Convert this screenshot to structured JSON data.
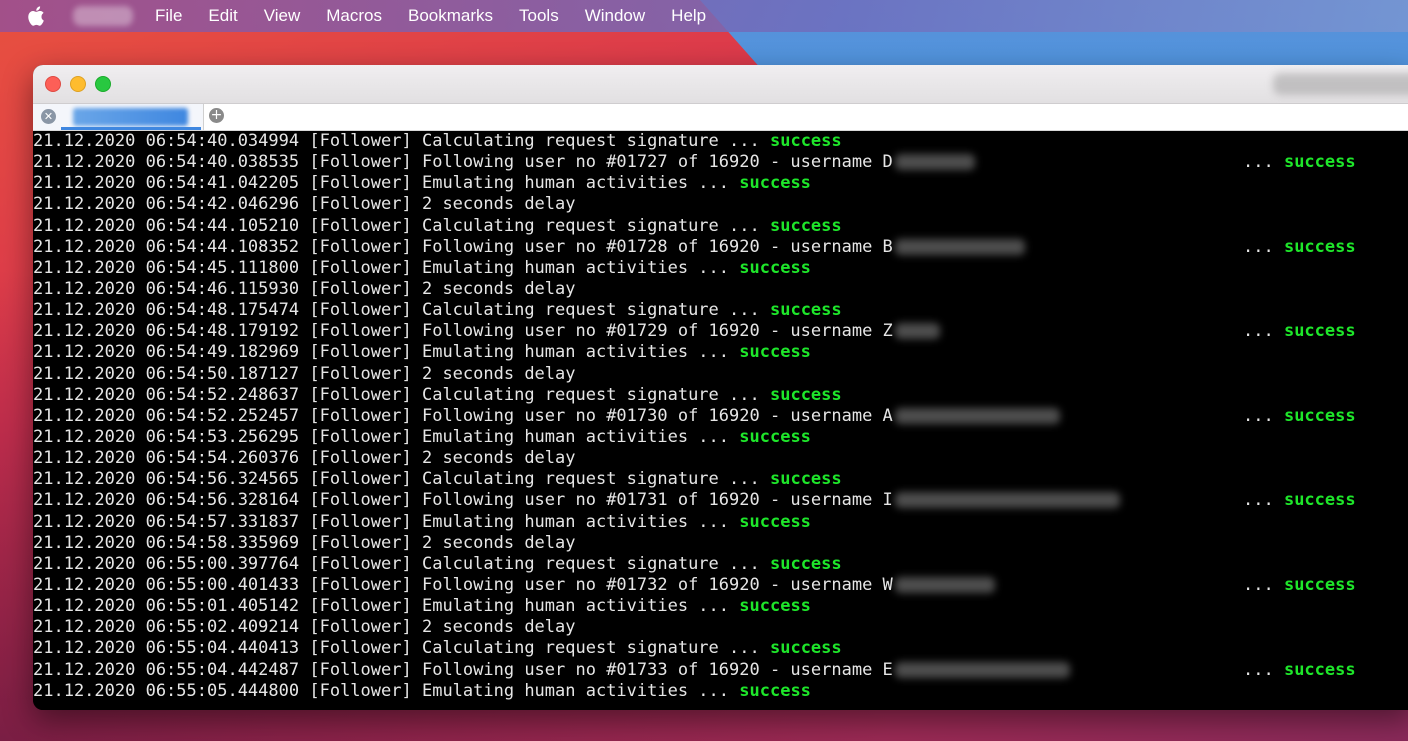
{
  "menubar": {
    "items": [
      "File",
      "Edit",
      "View",
      "Macros",
      "Bookmarks",
      "Tools",
      "Window",
      "Help"
    ]
  },
  "terminal": {
    "lines": [
      {
        "kind": "calc",
        "ts": "21.12.2020 06:54:40.034994",
        "tag": "[Follower]",
        "text": "Calculating request signature ...",
        "status": "success"
      },
      {
        "kind": "follow",
        "ts": "21.12.2020 06:54:40.038535",
        "tag": "[Follower]",
        "text": "Following user no #01727 of 16920 - username D",
        "redact_width": 80,
        "dots": "...",
        "status": "success"
      },
      {
        "kind": "emul",
        "ts": "21.12.2020 06:54:41.042205",
        "tag": "[Follower]",
        "text": "Emulating human activities ...",
        "status": "success"
      },
      {
        "kind": "delay",
        "ts": "21.12.2020 06:54:42.046296",
        "tag": "[Follower]",
        "text": "2 seconds delay"
      },
      {
        "kind": "calc",
        "ts": "21.12.2020 06:54:44.105210",
        "tag": "[Follower]",
        "text": "Calculating request signature ...",
        "status": "success"
      },
      {
        "kind": "follow",
        "ts": "21.12.2020 06:54:44.108352",
        "tag": "[Follower]",
        "text": "Following user no #01728 of 16920 - username B",
        "redact_width": 130,
        "dots": "...",
        "status": "success"
      },
      {
        "kind": "emul",
        "ts": "21.12.2020 06:54:45.111800",
        "tag": "[Follower]",
        "text": "Emulating human activities ...",
        "status": "success"
      },
      {
        "kind": "delay",
        "ts": "21.12.2020 06:54:46.115930",
        "tag": "[Follower]",
        "text": "2 seconds delay"
      },
      {
        "kind": "calc",
        "ts": "21.12.2020 06:54:48.175474",
        "tag": "[Follower]",
        "text": "Calculating request signature ...",
        "status": "success"
      },
      {
        "kind": "follow",
        "ts": "21.12.2020 06:54:48.179192",
        "tag": "[Follower]",
        "text": "Following user no #01729 of 16920 - username Z",
        "redact_width": 45,
        "dots": "...",
        "status": "success"
      },
      {
        "kind": "emul",
        "ts": "21.12.2020 06:54:49.182969",
        "tag": "[Follower]",
        "text": "Emulating human activities ...",
        "status": "success"
      },
      {
        "kind": "delay",
        "ts": "21.12.2020 06:54:50.187127",
        "tag": "[Follower]",
        "text": "2 seconds delay"
      },
      {
        "kind": "calc",
        "ts": "21.12.2020 06:54:52.248637",
        "tag": "[Follower]",
        "text": "Calculating request signature ...",
        "status": "success"
      },
      {
        "kind": "follow",
        "ts": "21.12.2020 06:54:52.252457",
        "tag": "[Follower]",
        "text": "Following user no #01730 of 16920 - username A",
        "redact_width": 165,
        "dots": "...",
        "status": "success"
      },
      {
        "kind": "emul",
        "ts": "21.12.2020 06:54:53.256295",
        "tag": "[Follower]",
        "text": "Emulating human activities ...",
        "status": "success"
      },
      {
        "kind": "delay",
        "ts": "21.12.2020 06:54:54.260376",
        "tag": "[Follower]",
        "text": "2 seconds delay"
      },
      {
        "kind": "calc",
        "ts": "21.12.2020 06:54:56.324565",
        "tag": "[Follower]",
        "text": "Calculating request signature ...",
        "status": "success"
      },
      {
        "kind": "follow",
        "ts": "21.12.2020 06:54:56.328164",
        "tag": "[Follower]",
        "text": "Following user no #01731 of 16920 - username I",
        "redact_width": 225,
        "dots": "...",
        "status": "success"
      },
      {
        "kind": "emul",
        "ts": "21.12.2020 06:54:57.331837",
        "tag": "[Follower]",
        "text": "Emulating human activities ...",
        "status": "success"
      },
      {
        "kind": "delay",
        "ts": "21.12.2020 06:54:58.335969",
        "tag": "[Follower]",
        "text": "2 seconds delay"
      },
      {
        "kind": "calc",
        "ts": "21.12.2020 06:55:00.397764",
        "tag": "[Follower]",
        "text": "Calculating request signature ...",
        "status": "success"
      },
      {
        "kind": "follow",
        "ts": "21.12.2020 06:55:00.401433",
        "tag": "[Follower]",
        "text": "Following user no #01732 of 16920 - username W",
        "redact_width": 100,
        "dots": "...",
        "status": "success"
      },
      {
        "kind": "emul",
        "ts": "21.12.2020 06:55:01.405142",
        "tag": "[Follower]",
        "text": "Emulating human activities ...",
        "status": "success"
      },
      {
        "kind": "delay",
        "ts": "21.12.2020 06:55:02.409214",
        "tag": "[Follower]",
        "text": "2 seconds delay"
      },
      {
        "kind": "calc",
        "ts": "21.12.2020 06:55:04.440413",
        "tag": "[Follower]",
        "text": "Calculating request signature ...",
        "status": "success"
      },
      {
        "kind": "follow",
        "ts": "21.12.2020 06:55:04.442487",
        "tag": "[Follower]",
        "text": "Following user no #01733 of 16920 - username E",
        "redact_width": 175,
        "dots": "...",
        "status": "success"
      },
      {
        "kind": "emul",
        "ts": "21.12.2020 06:55:05.444800",
        "tag": "[Follower]",
        "text": "Emulating human activities ...",
        "status": "success"
      }
    ]
  }
}
